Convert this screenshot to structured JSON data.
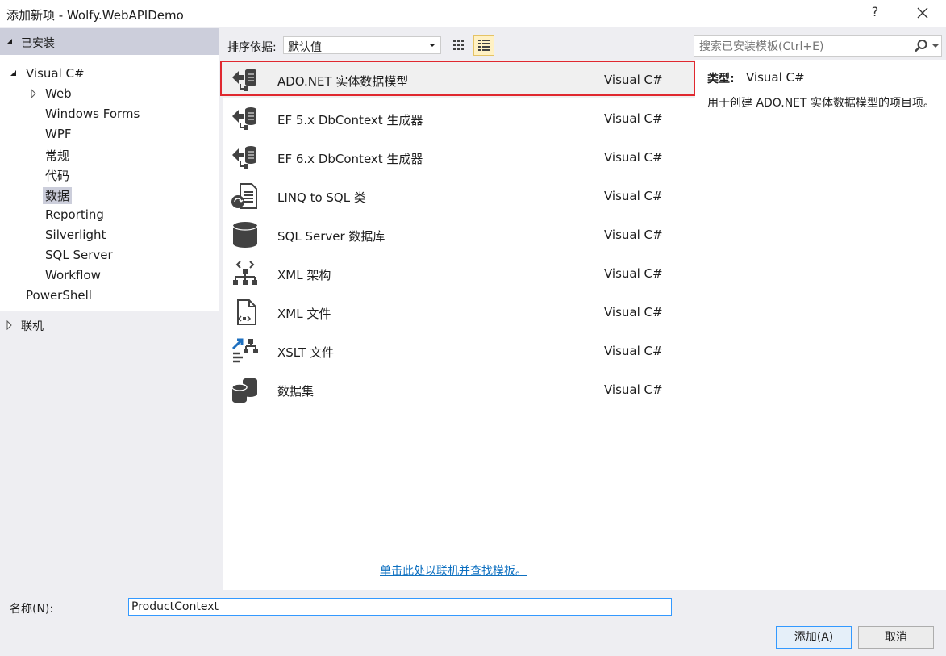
{
  "window": {
    "title": "添加新项 - Wolfy.WebAPIDemo",
    "help_label": "?"
  },
  "sidebar": {
    "installed_label": "已安装",
    "root_label": "Visual C#",
    "items": [
      {
        "label": "Web"
      },
      {
        "label": "Windows Forms"
      },
      {
        "label": "WPF"
      },
      {
        "label": "常规"
      },
      {
        "label": "代码"
      },
      {
        "label": "数据",
        "selected": true
      },
      {
        "label": "Reporting"
      },
      {
        "label": "Silverlight"
      },
      {
        "label": "SQL Server"
      },
      {
        "label": "Workflow"
      }
    ],
    "powershell_label": "PowerShell",
    "online_label": "联机"
  },
  "toolbar": {
    "sort_label": "排序依据:",
    "sort_value": "默认值",
    "search_placeholder": "搜索已安装模板(Ctrl+E)"
  },
  "templates": [
    {
      "name": "ADO.NET 实体数据模型",
      "type": "Visual C#",
      "icon": "entity-model-icon",
      "selected": true
    },
    {
      "name": "EF 5.x DbContext 生成器",
      "type": "Visual C#",
      "icon": "entity-model-icon"
    },
    {
      "name": "EF 6.x DbContext 生成器",
      "type": "Visual C#",
      "icon": "entity-model-icon"
    },
    {
      "name": "LINQ to SQL 类",
      "type": "Visual C#",
      "icon": "linq-to-sql-icon"
    },
    {
      "name": "SQL Server 数据库",
      "type": "Visual C#",
      "icon": "database-icon"
    },
    {
      "name": "XML 架构",
      "type": "Visual C#",
      "icon": "xml-schema-icon"
    },
    {
      "name": "XML 文件",
      "type": "Visual C#",
      "icon": "xml-file-icon"
    },
    {
      "name": "XSLT 文件",
      "type": "Visual C#",
      "icon": "xslt-file-icon"
    },
    {
      "name": "数据集",
      "type": "Visual C#",
      "icon": "dataset-icon"
    }
  ],
  "online_link": "单击此处以联机并查找模板。",
  "details": {
    "type_label": "类型:",
    "type_value": "Visual C#",
    "description": "用于创建 ADO.NET 实体数据模型的项目项。"
  },
  "footer": {
    "name_label": "名称(N):",
    "name_value": "ProductContext",
    "add_label": "添加(A)",
    "cancel_label": "取消"
  },
  "colors": {
    "selection_outline": "#e0282f",
    "link": "#0e70c0",
    "header_bg": "#cccedb",
    "active_view_bg": "#fff1c4"
  }
}
